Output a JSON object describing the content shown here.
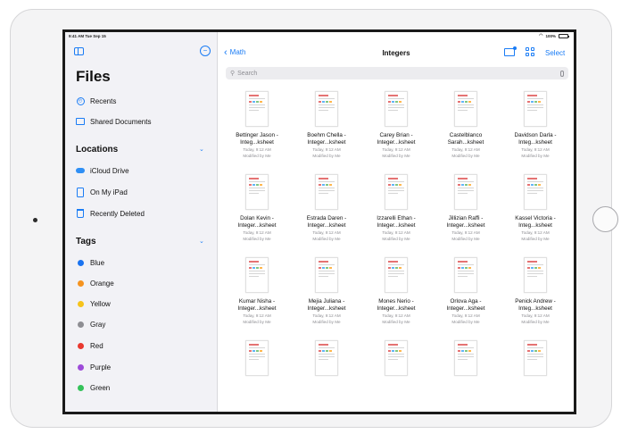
{
  "status_bar": {
    "time_date": "9:41 AM  Tue Sep 15",
    "battery": "100%"
  },
  "sidebar": {
    "title": "Files",
    "favorites": [
      {
        "label": "Recents",
        "icon": "recents-icon"
      },
      {
        "label": "Shared Documents",
        "icon": "shared-folder-icon"
      }
    ],
    "locations_header": "Locations",
    "locations": [
      {
        "label": "iCloud Drive",
        "icon": "icloud-icon"
      },
      {
        "label": "On My iPad",
        "icon": "ipad-icon"
      },
      {
        "label": "Recently Deleted",
        "icon": "trash-icon"
      }
    ],
    "tags_header": "Tags",
    "tags": [
      {
        "label": "Blue",
        "color": "#1a73f0"
      },
      {
        "label": "Orange",
        "color": "#f5931f"
      },
      {
        "label": "Yellow",
        "color": "#f6c31b"
      },
      {
        "label": "Gray",
        "color": "#8e8e93"
      },
      {
        "label": "Red",
        "color": "#e9382f"
      },
      {
        "label": "Purple",
        "color": "#9d4bd9"
      },
      {
        "label": "Green",
        "color": "#35c25a"
      }
    ]
  },
  "main": {
    "back_label": "Math",
    "title": "Integers",
    "select_label": "Select",
    "search_placeholder": "Search",
    "files": [
      {
        "name": "Bettinger Jason - Integ...ksheet",
        "date": "Today, 9:12 AM",
        "modified": "Modified by Me"
      },
      {
        "name": "Boehm Chella - Integer...ksheet",
        "date": "Today, 9:12 AM",
        "modified": "Modified by Me"
      },
      {
        "name": "Carey Brian - Integer...ksheet",
        "date": "Today, 9:12 AM",
        "modified": "Modified by Me"
      },
      {
        "name": "Castelblanco Sarah...ksheet",
        "date": "Today, 9:12 AM",
        "modified": "Modified by Me"
      },
      {
        "name": "Davidson Darla - Integ...ksheet",
        "date": "Today, 9:12 AM",
        "modified": "Modified by Me"
      },
      {
        "name": "Dolan Kevin - Integer...ksheet",
        "date": "Today, 9:12 AM",
        "modified": "Modified by Me"
      },
      {
        "name": "Estrada Daren - Integer...ksheet",
        "date": "Today, 9:12 AM",
        "modified": "Modified by Me"
      },
      {
        "name": "Izzarelli Ethan - Integer...ksheet",
        "date": "Today, 9:12 AM",
        "modified": "Modified by Me"
      },
      {
        "name": "Jillizian Raffi - Integer...ksheet",
        "date": "Today, 9:12 AM",
        "modified": "Modified by Me"
      },
      {
        "name": "Kassel Victoria - Integ...ksheet",
        "date": "Today, 9:12 AM",
        "modified": "Modified by Me"
      },
      {
        "name": "Kumar Nisha - Integer...ksheet",
        "date": "Today, 9:12 AM",
        "modified": "Modified by Me"
      },
      {
        "name": "Mejia Juliana - Integer...ksheet",
        "date": "Today, 9:12 AM",
        "modified": "Modified by Me"
      },
      {
        "name": "Mones Nerio - Integer...ksheet",
        "date": "Today, 9:12 AM",
        "modified": "Modified by Me"
      },
      {
        "name": "Orlova Aga - Integer...ksheet",
        "date": "Today, 9:12 AM",
        "modified": "Modified by Me"
      },
      {
        "name": "Penick Andrew - Integ...ksheet",
        "date": "Today, 9:12 AM",
        "modified": "Modified by Me"
      },
      {
        "name": "",
        "date": "",
        "modified": ""
      },
      {
        "name": "",
        "date": "",
        "modified": ""
      },
      {
        "name": "",
        "date": "",
        "modified": ""
      },
      {
        "name": "",
        "date": "",
        "modified": ""
      },
      {
        "name": "",
        "date": "",
        "modified": ""
      }
    ]
  }
}
